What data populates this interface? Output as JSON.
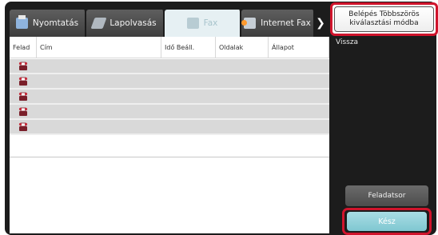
{
  "tabs": [
    {
      "label": "Nyomtatás",
      "icon": "printer-icon",
      "active": false
    },
    {
      "label": "Lapolvasás",
      "icon": "scanner-icon",
      "active": false
    },
    {
      "label": "Fax",
      "icon": "fax-icon",
      "active": true
    },
    {
      "label": "Internet Fax",
      "icon": "internet-fax-icon",
      "active": false
    }
  ],
  "tab_scroll_icon": "chevron-right-icon",
  "table": {
    "columns": [
      "Felad",
      "Cím",
      "Idő Beáll.",
      "Oldalak",
      "Állapot"
    ],
    "rows": [
      {
        "icon": "fax-job-icon"
      },
      {
        "icon": "fax-job-icon"
      },
      {
        "icon": "fax-job-icon"
      },
      {
        "icon": "fax-job-icon"
      },
      {
        "icon": "fax-job-icon"
      }
    ]
  },
  "side": {
    "multi_select_label": "Belépés Többszörös\nkiválasztási módba",
    "back_label": "Vissza",
    "job_list_label": "Feladatsor",
    "done_label": "Kész"
  },
  "colors": {
    "highlight": "#d0142c",
    "done_button": "#8fd0da",
    "frame": "#1c1c1c"
  }
}
